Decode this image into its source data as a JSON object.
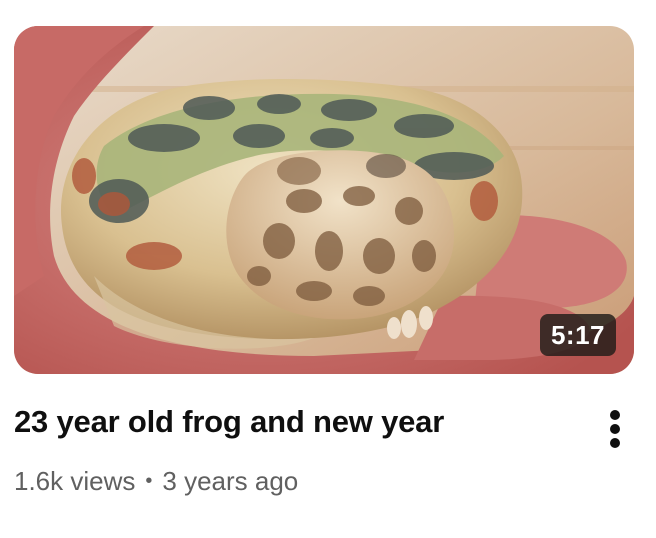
{
  "video": {
    "duration": "5:17",
    "title": "23 year old frog and new year",
    "views": "1.6k views",
    "separator": "•",
    "age": "3 years ago",
    "thumbnail_subject": "frog-in-hand",
    "more_icon": "vertical-ellipsis-icon"
  }
}
